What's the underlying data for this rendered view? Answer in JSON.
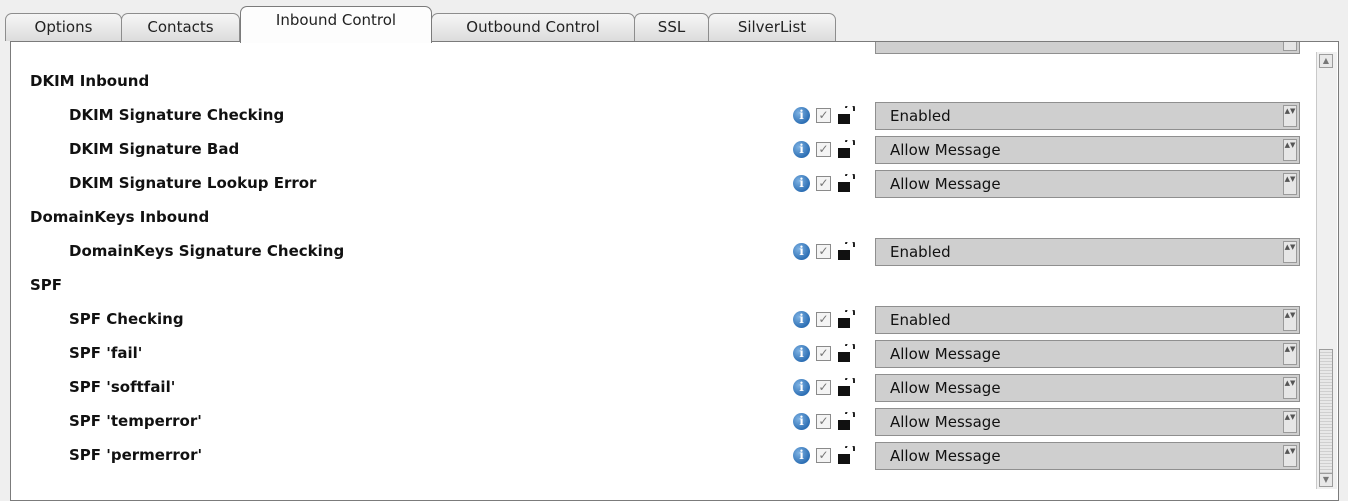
{
  "tabs": [
    {
      "label": "Options"
    },
    {
      "label": "Contacts"
    },
    {
      "label": "Inbound Control"
    },
    {
      "label": "Outbound Control"
    },
    {
      "label": "SSL"
    },
    {
      "label": "SilverList"
    }
  ],
  "active_tab": "Inbound Control",
  "sections": [
    {
      "title": "DKIM Inbound",
      "items": [
        {
          "label": "DKIM Signature Checking",
          "value": "Enabled"
        },
        {
          "label": "DKIM Signature Bad",
          "value": "Allow Message"
        },
        {
          "label": "DKIM Signature Lookup Error",
          "value": "Allow Message"
        }
      ]
    },
    {
      "title": "DomainKeys Inbound",
      "items": [
        {
          "label": "DomainKeys Signature Checking",
          "value": "Enabled"
        }
      ]
    },
    {
      "title": "SPF",
      "items": [
        {
          "label": "SPF Checking",
          "value": "Enabled"
        },
        {
          "label": "SPF 'fail'",
          "value": "Allow Message"
        },
        {
          "label": "SPF 'softfail'",
          "value": "Allow Message"
        },
        {
          "label": "SPF 'temperror'",
          "value": "Allow Message"
        },
        {
          "label": "SPF 'permerror'",
          "value": "Allow Message"
        }
      ]
    }
  ],
  "icons": {
    "info": "info-icon",
    "check": "checkbox-icon",
    "lock": "unlock-icon"
  },
  "glyphs": {
    "info": "i",
    "check": "✓",
    "arrow_up": "▲",
    "arrow_down": "▼",
    "select_arrows": "▲▼"
  },
  "colors": {
    "select_bg": "#cfcfcf",
    "info_blue": "#2d6fb4"
  }
}
